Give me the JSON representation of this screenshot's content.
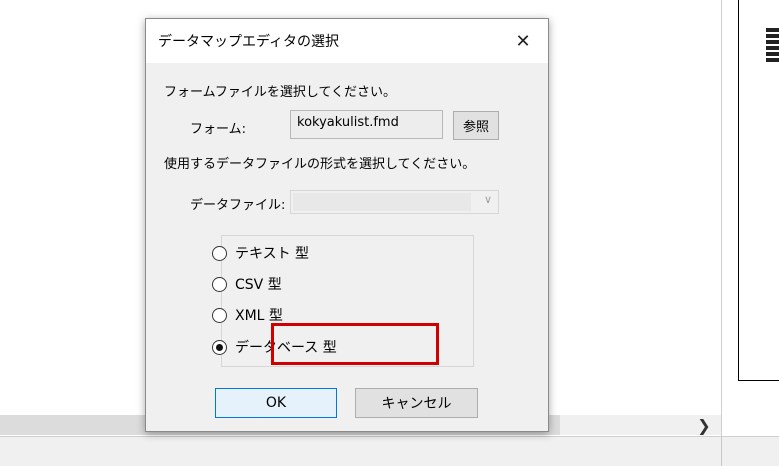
{
  "dialog": {
    "title": "データマップエディタの選択",
    "form_prompt": "フォームファイルを選択してください。",
    "form_label": "フォーム:",
    "form_value": "kokyakulist.fmd",
    "browse_label": "参照",
    "type_prompt": "使用するデータファイルの形式を選択してください。",
    "datafile_label": "データファイル:",
    "datafile_value": "",
    "options": [
      {
        "label": "テキスト 型",
        "checked": false
      },
      {
        "label": "CSV 型",
        "checked": false
      },
      {
        "label": "XML 型",
        "checked": false
      },
      {
        "label": "データベース 型",
        "checked": true
      }
    ],
    "ok_label": "OK",
    "cancel_label": "キャンセル"
  },
  "icons": {
    "close": "close-icon",
    "dropdown": "chevron-down-icon",
    "scroll_right": "chevron-right-icon"
  },
  "colors": {
    "highlight": "#d10000",
    "ok_border": "#0078d7",
    "dialog_bg": "#f0f0f0"
  }
}
